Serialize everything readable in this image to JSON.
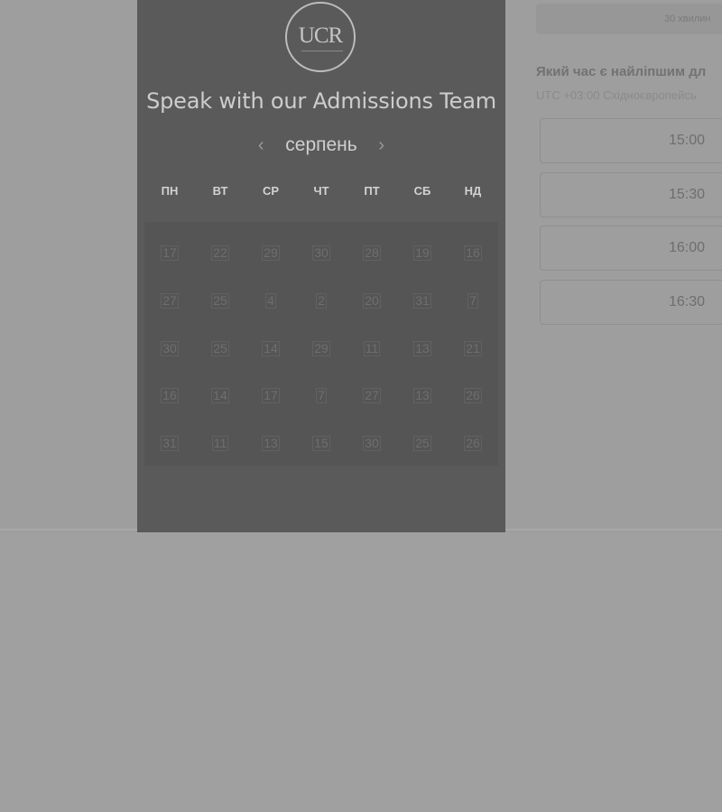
{
  "scheduler": {
    "title": "Speak with our Admissions Team",
    "logo_text": "UCR",
    "month_label": "серпень",
    "prev_arrow": "‹",
    "next_arrow": "›",
    "weekdays": [
      "ПН",
      "ВТ",
      "СР",
      "ЧТ",
      "ПТ",
      "СБ",
      "НД"
    ],
    "days": [
      [
        "17",
        "22",
        "29",
        "30",
        "28",
        "19",
        "16"
      ],
      [
        "27",
        "25",
        "4",
        "2",
        "20",
        "31",
        "7"
      ],
      [
        "30",
        "25",
        "14",
        "29",
        "11",
        "13",
        "21"
      ],
      [
        "16",
        "14",
        "17",
        "7",
        "27",
        "13",
        "26"
      ],
      [
        "31",
        "11",
        "13",
        "15",
        "30",
        "25",
        "26"
      ]
    ]
  },
  "booking": {
    "duration_label": "30 хвилин",
    "heading": "Який час є найліпшим дл",
    "timezone": "UTC +03:00 Східноєвропейсь",
    "time_slots": [
      "15:00",
      "15:30",
      "16:00",
      "16:30"
    ]
  },
  "colors": {
    "overlay": "#9e9e9e",
    "panel": "#5a5a5a"
  }
}
